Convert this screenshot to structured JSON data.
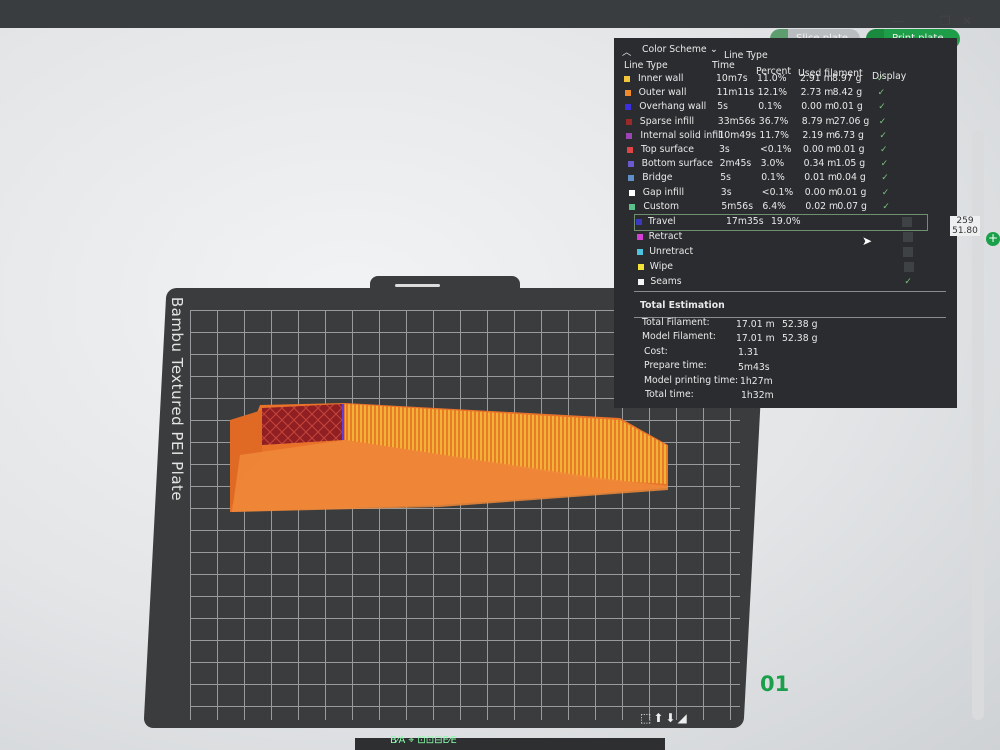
{
  "window": {
    "title": "",
    "controls": [
      "—",
      "❐",
      "✕"
    ]
  },
  "toolbar": {
    "slice_label": "Slice plate",
    "print_label": "Print plate",
    "dropdown_glyph": "⌄"
  },
  "legend": {
    "color_scheme_label": "Color Scheme",
    "line_type_dropdown": "Line Type",
    "headers": {
      "line_type": "Line Type",
      "time": "Time",
      "percent": "Percent",
      "used_filament": "Used filament",
      "display": "Display"
    },
    "rows": [
      {
        "name": "Inner wall",
        "time": "10m7s",
        "percent": "11.0%",
        "length": "2.91 m",
        "weight": "8.97 g",
        "color": "#f2c53d",
        "display": true
      },
      {
        "name": "Outer wall",
        "time": "11m11s",
        "percent": "12.1%",
        "length": "2.73 m",
        "weight": "8.42 g",
        "color": "#f08a2a",
        "display": true
      },
      {
        "name": "Overhang wall",
        "time": "5s",
        "percent": "0.1%",
        "length": "0.00 m",
        "weight": "0.01 g",
        "color": "#3b2fe0",
        "display": true
      },
      {
        "name": "Sparse infill",
        "time": "33m56s",
        "percent": "36.7%",
        "length": "8.79 m",
        "weight": "27.06 g",
        "color": "#9a2a2a",
        "display": true
      },
      {
        "name": "Internal solid infill",
        "time": "10m49s",
        "percent": "11.7%",
        "length": "2.19 m",
        "weight": "6.73 g",
        "color": "#9b45b5",
        "display": true
      },
      {
        "name": "Top surface",
        "time": "3s",
        "percent": "<0.1%",
        "length": "0.00 m",
        "weight": "0.01 g",
        "color": "#e04545",
        "display": true
      },
      {
        "name": "Bottom surface",
        "time": "2m45s",
        "percent": "3.0%",
        "length": "0.34 m",
        "weight": "1.05 g",
        "color": "#6a5ad0",
        "display": true
      },
      {
        "name": "Bridge",
        "time": "5s",
        "percent": "0.1%",
        "length": "0.01 m",
        "weight": "0.04 g",
        "color": "#5f8fc8",
        "display": true
      },
      {
        "name": "Gap infill",
        "time": "3s",
        "percent": "<0.1%",
        "length": "0.00 m",
        "weight": "0.01 g",
        "color": "#ffffff",
        "display": true
      },
      {
        "name": "Custom",
        "time": "5m56s",
        "percent": "6.4%",
        "length": "0.02 m",
        "weight": "0.07 g",
        "color": "#5cc08a",
        "display": true
      }
    ],
    "travel_rows": [
      {
        "name": "Travel",
        "time": "17m35s",
        "percent": "19.0%",
        "color": "#3a3ac0",
        "display": false,
        "selected": true
      },
      {
        "name": "Retract",
        "color": "#d43fd4",
        "display": false
      },
      {
        "name": "Unretract",
        "color": "#4fc2e0",
        "display": false
      },
      {
        "name": "Wipe",
        "color": "#f2e23a",
        "display": false
      },
      {
        "name": "Seams",
        "color": "#f5f5f5",
        "display": true
      }
    ],
    "total_estimation": {
      "title": "Total Estimation",
      "total_filament_label": "Total Filament:",
      "total_filament_length": "17.01 m",
      "total_filament_weight": "52.38 g",
      "model_filament_label": "Model Filament:",
      "model_filament_length": "17.01 m",
      "model_filament_weight": "52.38 g",
      "cost_label": "Cost:",
      "cost_value": "1.31",
      "prepare_label": "Prepare time:",
      "prepare_value": "5m43s",
      "model_print_label": "Model printing time:",
      "model_print_value": "1h27m",
      "total_time_label": "Total time:",
      "total_time_value": "1h32m"
    }
  },
  "plate": {
    "label": "Bambu Textured PEI Plate",
    "number": "01",
    "tool_glyphs": "⬚⬆⬇◢",
    "bottom_text": "B⁄A ⌖ ⊡⊡⊟E⁄E"
  },
  "layer_slider": {
    "top_layer": "259",
    "top_height": "51.80",
    "plus": "+"
  },
  "check_glyph": "✓",
  "cursor_glyph": "➤"
}
